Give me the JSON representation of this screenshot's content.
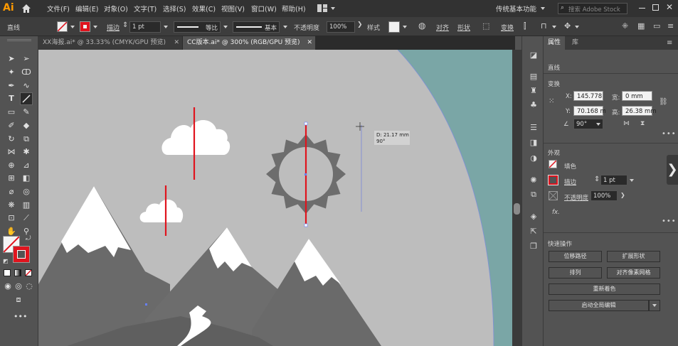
{
  "app": {
    "logo": "Ai"
  },
  "menu": {
    "items": [
      "文件(F)",
      "编辑(E)",
      "对象(O)",
      "文字(T)",
      "选择(S)",
      "效果(C)",
      "视图(V)",
      "窗口(W)",
      "帮助(H)"
    ],
    "workspace": "传统基本功能",
    "search_placeholder": "搜索 Adobe Stock"
  },
  "control": {
    "object_type": "直线",
    "stroke_label": "描边",
    "stroke_weight": "1 pt",
    "profile_label": "等比",
    "brush_label": "基本",
    "opacity_label": "不透明度",
    "opacity_value": "100%",
    "style_label": "样式",
    "align_label": "对齐",
    "shape_label": "形状",
    "transform_label": "变换"
  },
  "tabs": [
    {
      "label": "XX海报.ai* @ 33.33% (CMYK/GPU 预览)",
      "active": false
    },
    {
      "label": "CC版本.ai* @ 300% (RGB/GPU 预览)",
      "active": true
    }
  ],
  "canvas": {
    "measure_tooltip_line1": "D: 21.17 mm",
    "measure_tooltip_line2": "90°"
  },
  "panel": {
    "tabs": [
      "属性",
      "库"
    ],
    "object_type": "直线",
    "transform": {
      "title": "变换",
      "x_label": "X:",
      "x_value": "145.778",
      "y_label": "Y:",
      "y_value": "70.168 m",
      "w_label": "宽:",
      "w_value": "0 mm",
      "h_label": "高:",
      "h_value": "26.38 mm",
      "angle_value": "90°"
    },
    "appearance": {
      "title": "外观",
      "fill_label": "填色",
      "stroke_label": "描边",
      "stroke_value": "1 pt",
      "opacity_label": "不透明度",
      "opacity_value": "100%",
      "fx_label": "fx."
    },
    "quick_actions": {
      "title": "快速操作",
      "offset_path": "位移路径",
      "expand_shape": "扩展形状",
      "arrange": "排列",
      "align_pixel": "对齐像素网格",
      "recolor": "重新着色",
      "global_edit": "启动全局编辑"
    }
  },
  "colors": {
    "accent_red": "#e0141e",
    "canvas_bg": "#bdbdbd",
    "teal": "#7aa6a6",
    "mountain": "#6a6a6a",
    "snow": "#ffffff"
  }
}
